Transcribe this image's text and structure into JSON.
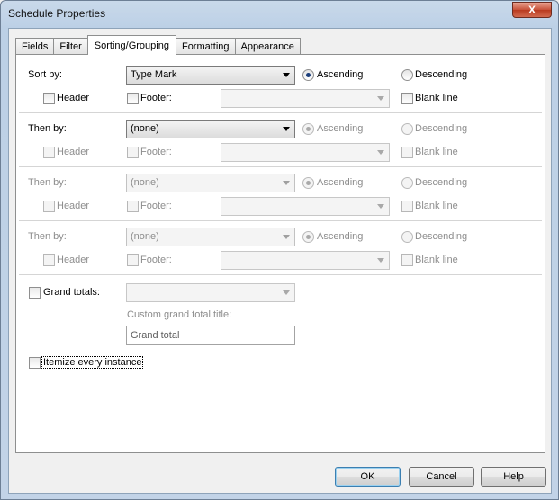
{
  "window": {
    "title": "Schedule Properties",
    "close_label": "X"
  },
  "tabs": [
    {
      "label": "Fields"
    },
    {
      "label": "Filter"
    },
    {
      "label": "Sorting/Grouping"
    },
    {
      "label": "Formatting"
    },
    {
      "label": "Appearance"
    }
  ],
  "active_tab": "Sorting/Grouping",
  "sort_groups": [
    {
      "label": "Sort by:",
      "value": "Type Mark",
      "ascending": "Ascending",
      "descending": "Descending",
      "header": "Header",
      "footer": "Footer:",
      "blank_line": "Blank line",
      "footer_value": ""
    },
    {
      "label": "Then by:",
      "value": "(none)",
      "ascending": "Ascending",
      "descending": "Descending",
      "header": "Header",
      "footer": "Footer:",
      "blank_line": "Blank line",
      "footer_value": ""
    },
    {
      "label": "Then by:",
      "value": "(none)",
      "ascending": "Ascending",
      "descending": "Descending",
      "header": "Header",
      "footer": "Footer:",
      "blank_line": "Blank line",
      "footer_value": ""
    },
    {
      "label": "Then by:",
      "value": "(none)",
      "ascending": "Ascending",
      "descending": "Descending",
      "header": "Header",
      "footer": "Footer:",
      "blank_line": "Blank line",
      "footer_value": ""
    }
  ],
  "grand_totals": {
    "label": "Grand totals:",
    "value": "",
    "custom_title_label": "Custom grand total title:",
    "custom_title_value": "Grand total"
  },
  "itemize": {
    "label": "Itemize every instance"
  },
  "buttons": {
    "ok": "OK",
    "cancel": "Cancel",
    "help": "Help"
  }
}
